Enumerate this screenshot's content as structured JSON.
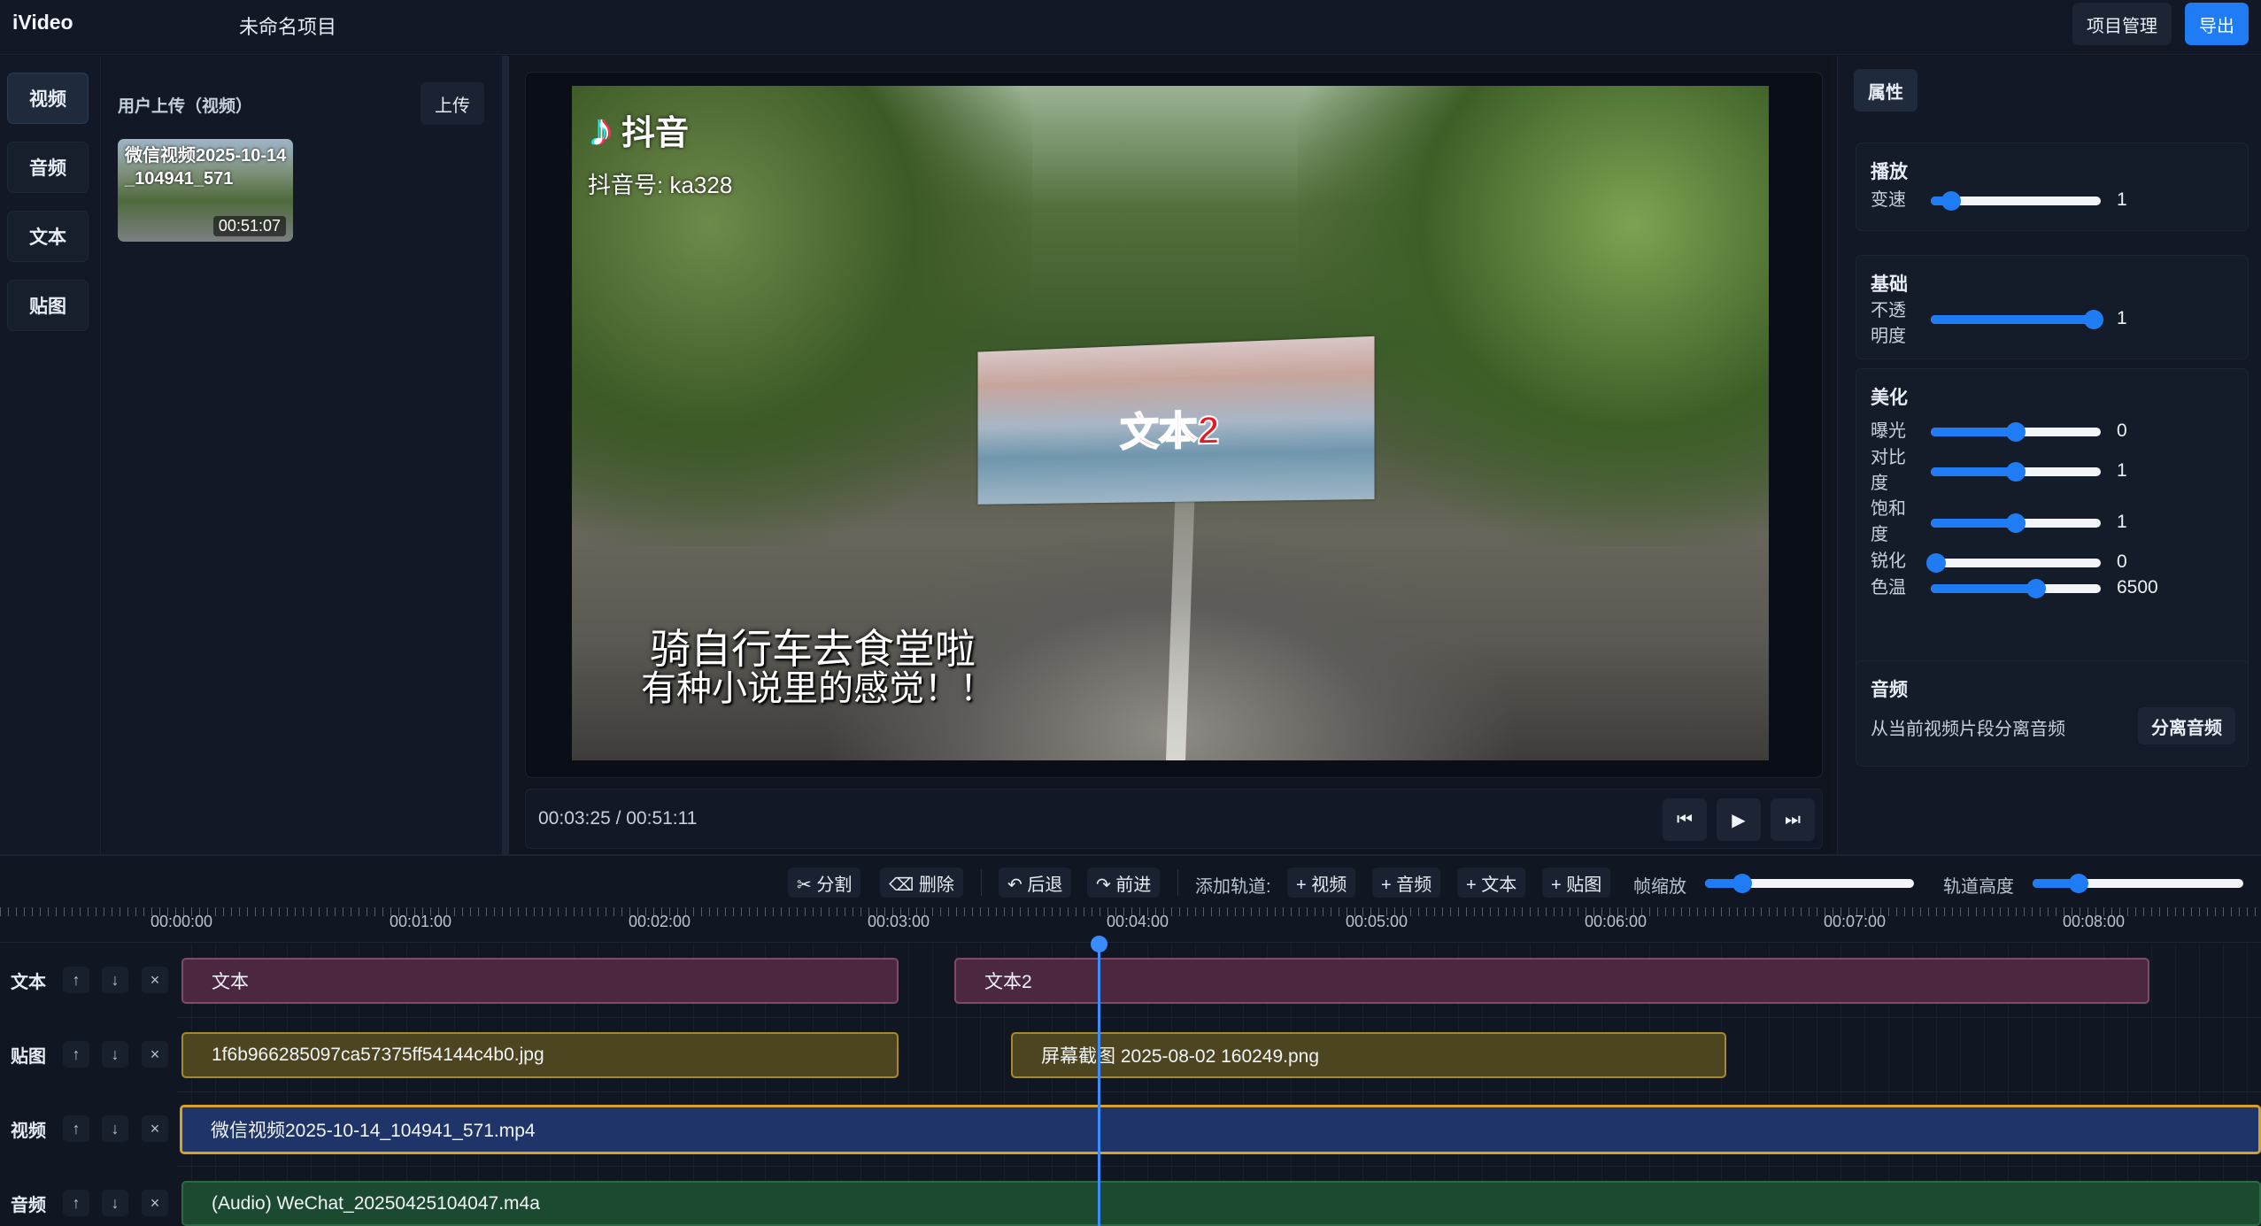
{
  "app": {
    "title": "iVideo",
    "project_name": "未命名项目",
    "manage_label": "项目管理",
    "export_label": "导出"
  },
  "nav": {
    "items": [
      "视频",
      "音频",
      "文本",
      "贴图"
    ]
  },
  "library": {
    "title": "用户上传（视频）",
    "upload_label": "上传",
    "items": [
      {
        "name": "微信视频2025-10-14_104941_571",
        "duration": "00:51:07"
      }
    ]
  },
  "preview": {
    "watermark_brand": "抖音",
    "watermark_id": "抖音号: ka328",
    "overlay_text": "文本2",
    "caption_line1": "骑自行车去食堂啦",
    "caption_line2": "有种小说里的感觉！！",
    "icons": {
      "logo": "tiktok-note-icon"
    }
  },
  "player": {
    "current_time": "00:03:25",
    "total_time": "00:51:11",
    "time_display": "00:03:25 / 00:51:11",
    "prev_icon": "⏮",
    "play_icon": "▶",
    "next_icon": "⏭"
  },
  "props": {
    "tab": "属性",
    "playback": {
      "title": "播放",
      "speed_label": "变速",
      "speed_value": "1",
      "speed_fraction": 0.12
    },
    "basic": {
      "title": "基础",
      "opacity_label": "不透明度",
      "opacity_value": "1",
      "opacity_fraction": 0.96
    },
    "beauty": {
      "title": "美化",
      "exposure": {
        "label": "曝光",
        "value": "0",
        "fraction": 0.5
      },
      "contrast": {
        "label": "对比度",
        "value": "1",
        "fraction": 0.5
      },
      "saturation": {
        "label": "饱和度",
        "value": "1",
        "fraction": 0.5
      },
      "sharpen": {
        "label": "锐化",
        "value": "0",
        "fraction": 0.03
      },
      "temperature": {
        "label": "色温",
        "value": "6500",
        "fraction": 0.62
      }
    },
    "audio": {
      "title": "音频",
      "description": "从当前视频片段分离音频",
      "split_label": "分离音频"
    }
  },
  "timeline": {
    "toolbar": {
      "split": "✂ 分割",
      "delete": "⌫ 删除",
      "undo": "↶ 后退",
      "redo": "↷ 前进",
      "add_track_label": "添加轨道:",
      "add_video": "+ 视频",
      "add_audio": "+ 音频",
      "add_text": "+ 文本",
      "add_sticker": "+ 贴图",
      "zoom_label": "帧缩放",
      "zoom_fraction": 0.18,
      "height_label": "轨道高度",
      "height_fraction": 0.22
    },
    "ruler": [
      "00:00:00",
      "00:01:00",
      "00:02:00",
      "00:03:00",
      "00:04:00",
      "00:05:00",
      "00:06:00",
      "00:07:00",
      "00:08:00"
    ],
    "tracks": [
      {
        "name": "文本",
        "clips": [
          "文本",
          "文本2"
        ]
      },
      {
        "name": "贴图",
        "clips": [
          "1f6b966285097ca57375ff54144c4b0.jpg",
          "屏幕截图 2025-08-02 160249.png"
        ]
      },
      {
        "name": "视频",
        "clips": [
          "微信视频2025-10-14_104941_571.mp4"
        ]
      },
      {
        "name": "音频",
        "clips": [
          "(Audio) WeChat_20250425104047.m4a"
        ]
      }
    ],
    "track_buttons": {
      "up": "↑",
      "down": "↓",
      "remove": "×"
    }
  }
}
